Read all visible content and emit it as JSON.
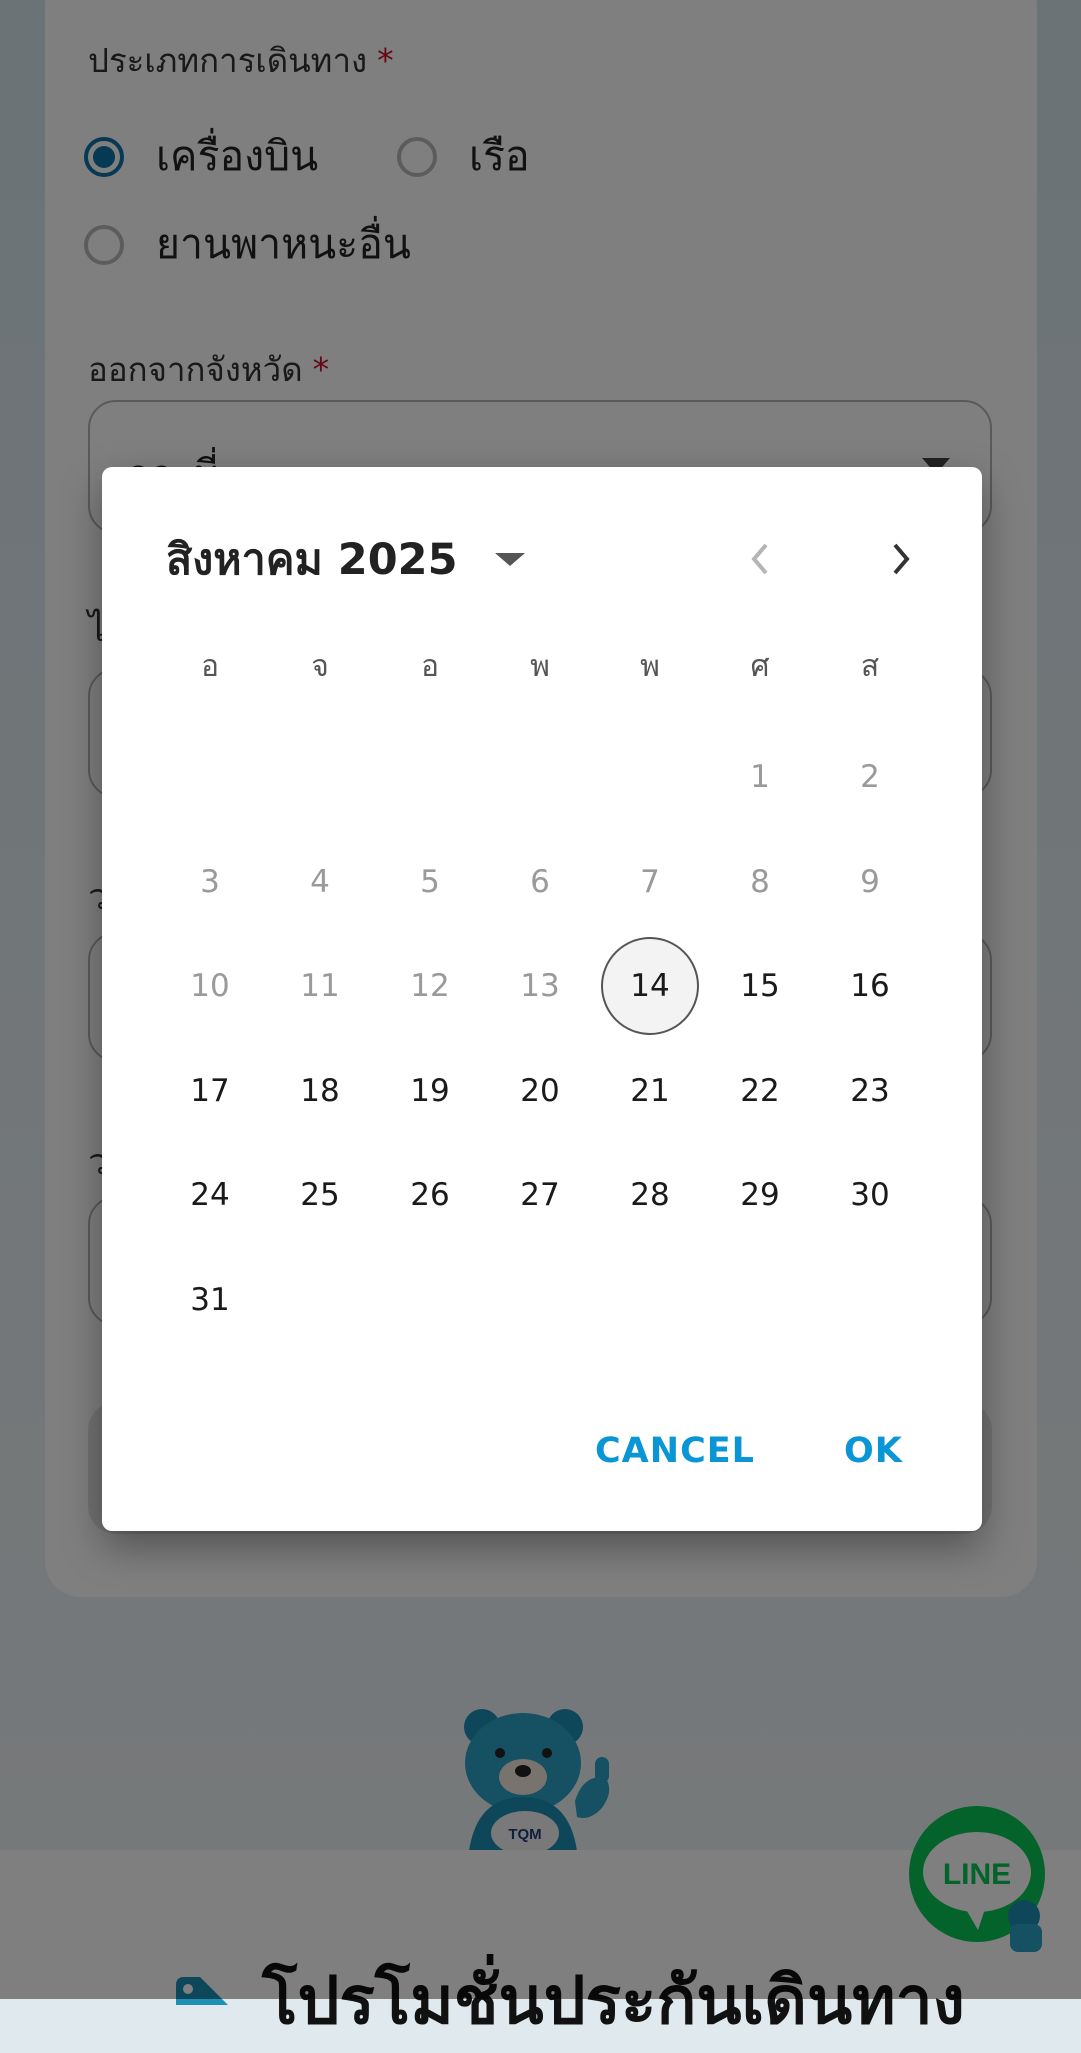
{
  "form": {
    "travel_type_label": "ประเภทการเดินทาง",
    "required_mark": "*",
    "travel_options": [
      {
        "label": "เครื่องบิน",
        "checked": true
      },
      {
        "label": "เรือ",
        "checked": false
      },
      {
        "label": "ยานพาหนะอื่น",
        "checked": false
      }
    ],
    "departure_label": "ออกจากจังหวัด",
    "departure_value": "กระบี่",
    "partial_label_1": "ไ",
    "partial_label_2": "ว",
    "partial_label_3": "ว"
  },
  "datepicker": {
    "month_label": "สิงหาคม 2025",
    "weekdays": [
      "อ",
      "จ",
      "อ",
      "พ",
      "พ",
      "ศ",
      "ส"
    ],
    "weeks": [
      [
        null,
        null,
        null,
        null,
        null,
        "1",
        "2"
      ],
      [
        "3",
        "4",
        "5",
        "6",
        "7",
        "8",
        "9"
      ],
      [
        "10",
        "11",
        "12",
        "13",
        "14",
        "15",
        "16"
      ],
      [
        "17",
        "18",
        "19",
        "20",
        "21",
        "22",
        "23"
      ],
      [
        "24",
        "25",
        "26",
        "27",
        "28",
        "29",
        "30"
      ],
      [
        "31",
        null,
        null,
        null,
        null,
        null,
        null
      ]
    ],
    "first_enabled_day": 14,
    "today": 14,
    "cancel_label": "CANCEL",
    "ok_label": "OK"
  },
  "promo": {
    "title": "โปรโมชั่นประกันเดินทาง"
  },
  "mascot_text": "TQM",
  "line_text": "LINE",
  "colors": {
    "accent": "#0a96d4",
    "radio_checked": "#0a72a8",
    "required": "#c8102e",
    "line_green": "#06c755",
    "mascot_blue": "#1e8fb5"
  }
}
